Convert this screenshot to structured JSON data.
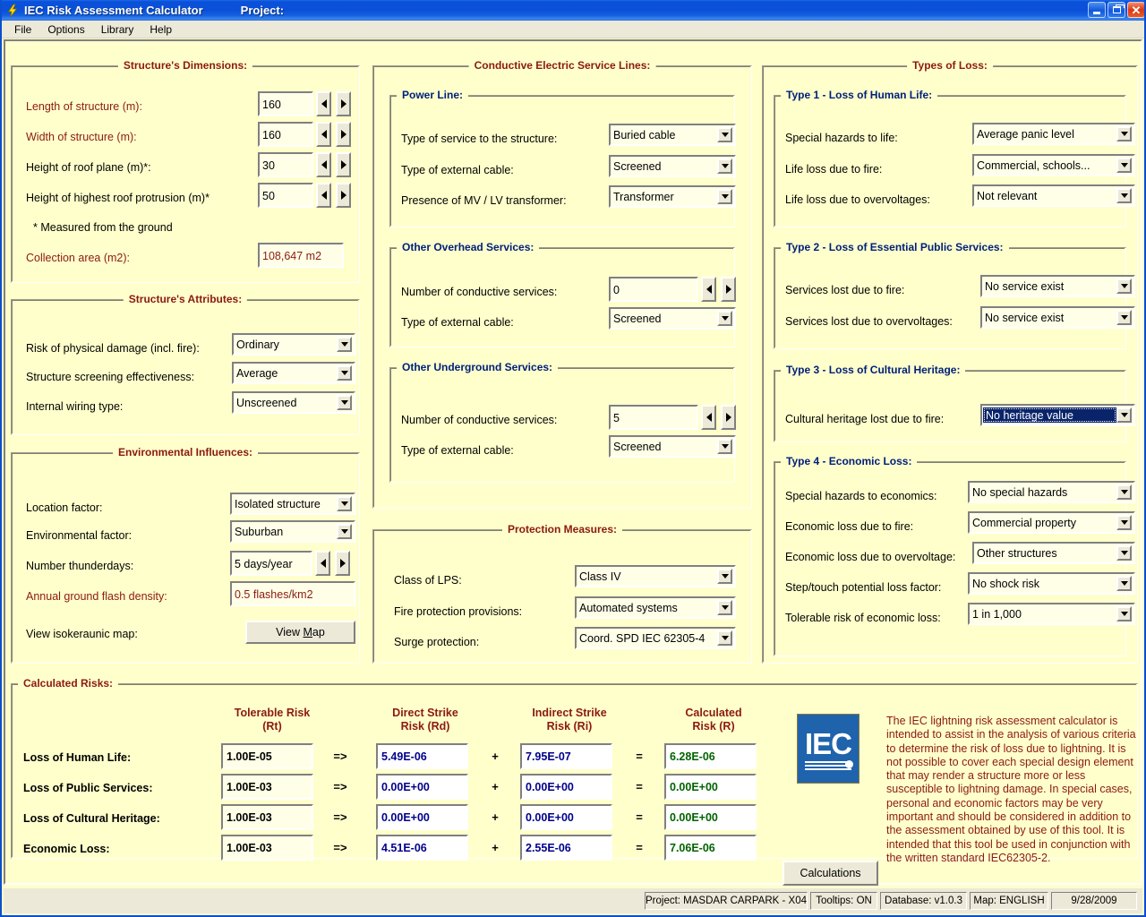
{
  "window": {
    "title": "IEC Risk Assessment Calculator",
    "project_label": "Project:",
    "icon": "lightning-bolt-icon",
    "minimize": "minimize-icon",
    "restore": "restore-icon",
    "close": "close-icon"
  },
  "menu": [
    "File",
    "Options",
    "Library",
    "Help"
  ],
  "structure_dimensions": {
    "title": "Structure's Dimensions:",
    "fields": [
      {
        "label": "Length of structure (m):",
        "value": "160"
      },
      {
        "label": "Width of structure (m):",
        "value": "160"
      },
      {
        "label": "Height of roof plane (m)*:",
        "value": "30"
      },
      {
        "label": "Height of highest roof protrusion (m)*",
        "value": "50"
      }
    ],
    "note": "* Measured from the ground",
    "collection_area_label": "Collection area (m2):",
    "collection_area_value": "108,647 m2"
  },
  "structure_attributes": {
    "title": "Structure's Attributes:",
    "rows": [
      {
        "label": "Risk of physical damage (incl. fire):",
        "value": "Ordinary"
      },
      {
        "label": "Structure screening effectiveness:",
        "value": "Average"
      },
      {
        "label": "Internal wiring type:",
        "value": "Unscreened"
      }
    ]
  },
  "environmental_influences": {
    "title": "Environmental Influences:",
    "location_factor_label": "Location factor:",
    "location_factor_value": "Isolated structure",
    "environmental_factor_label": "Environmental factor:",
    "environmental_factor_value": "Suburban",
    "thunderdays_label": "Number thunderdays:",
    "thunderdays_value": "5 days/year",
    "flash_density_label": "Annual ground flash density:",
    "flash_density_value": "0.5  flashes/km2",
    "map_label": "View isokeraunic map:",
    "map_button": "View Map"
  },
  "conductive_lines": {
    "title": "Conductive Electric Service Lines:",
    "power_line": {
      "title": "Power Line:",
      "rows": [
        {
          "label": "Type of service to the structure:",
          "value": "Buried cable"
        },
        {
          "label": "Type of external cable:",
          "value": "Screened"
        },
        {
          "label": "Presence of MV / LV transformer:",
          "value": "Transformer"
        }
      ]
    },
    "overhead": {
      "title": "Other Overhead Services:",
      "count_label": "Number of conductive services:",
      "count_value": "0",
      "cable_label": "Type of external cable:",
      "cable_value": "Screened"
    },
    "underground": {
      "title": "Other Underground Services:",
      "count_label": "Number of conductive services:",
      "count_value": "5",
      "cable_label": "Type of external cable:",
      "cable_value": "Screened"
    }
  },
  "protection_measures": {
    "title": "Protection Measures:",
    "rows": [
      {
        "label": "Class of LPS:",
        "value": "Class IV"
      },
      {
        "label": "Fire protection provisions:",
        "value": "Automated systems"
      },
      {
        "label": "Surge protection:",
        "value": "Coord. SPD IEC 62305-4"
      }
    ]
  },
  "types_of_loss": {
    "title": "Types of Loss:",
    "type1": {
      "title": "Type 1 - Loss of Human Life:",
      "rows": [
        {
          "label": "Special hazards to life:",
          "value": "Average panic level"
        },
        {
          "label": "Life loss due to fire:",
          "value": "Commercial, schools..."
        },
        {
          "label": "Life loss due to overvoltages:",
          "value": "Not relevant"
        }
      ]
    },
    "type2": {
      "title": "Type 2 - Loss of Essential Public Services:",
      "rows": [
        {
          "label": "Services lost due to fire:",
          "value": "No service exist"
        },
        {
          "label": "Services lost due to overvoltages:",
          "value": "No service exist"
        }
      ]
    },
    "type3": {
      "title": "Type 3 - Loss of Cultural Heritage:",
      "rows": [
        {
          "label": "Cultural heritage lost due to fire:",
          "value": "No heritage value"
        }
      ]
    },
    "type4": {
      "title": "Type 4 - Economic Loss:",
      "rows": [
        {
          "label": "Special hazards to economics:",
          "value": "No special hazards"
        },
        {
          "label": "Economic loss due to fire:",
          "value": "Commercial property"
        },
        {
          "label": "Economic loss due to overvoltage:",
          "value": "Other structures"
        },
        {
          "label": "Step/touch potential loss factor:",
          "value": "No shock risk"
        },
        {
          "label": "Tolerable risk of economic loss:",
          "value": "1 in 1,000"
        }
      ]
    }
  },
  "calculated_risks": {
    "title": "Calculated Risks:",
    "headers": {
      "tolerable": [
        "Tolerable Risk",
        "(Rt)"
      ],
      "direct": [
        "Direct Strike",
        "Risk (Rd)"
      ],
      "indirect": [
        "Indirect Strike",
        "Risk (Ri)"
      ],
      "calculated": [
        "Calculated",
        "Risk (R)"
      ]
    },
    "op_arrow": "=>",
    "op_plus": "+",
    "op_equals": "=",
    "rows": [
      {
        "label": "Loss of Human Life:",
        "rt": "1.00E-05",
        "rd": "5.49E-06",
        "ri": "7.95E-07",
        "r": "6.28E-06"
      },
      {
        "label": "Loss of Public Services:",
        "rt": "1.00E-03",
        "rd": "0.00E+00",
        "ri": "0.00E+00",
        "r": "0.00E+00"
      },
      {
        "label": "Loss of Cultural Heritage:",
        "rt": "1.00E-03",
        "rd": "0.00E+00",
        "ri": "0.00E+00",
        "r": "0.00E+00"
      },
      {
        "label": "Economic Loss:",
        "rt": "1.00E-03",
        "rd": "4.51E-06",
        "ri": "2.55E-06",
        "r": "7.06E-06"
      }
    ]
  },
  "info": {
    "logo_text": "IEC",
    "description": "The IEC lightning risk assessment calculator is intended to assist in the analysis of various criteria to determine the risk of loss due to lightning. It is not possible to cover each special design element that may render a structure more or less susceptible to lightning damage. In special cases, personal and economic factors may be very important and should be considered in addition to the assessment obtained by use of this tool. It is intended that this tool be used in conjunction with the written standard IEC62305-2.",
    "calculations_button": "Calculations"
  },
  "statusbar": {
    "project": "Project: MASDAR CARPARK - X04",
    "tooltips": "Tooltips: ON",
    "database": "Database: v1.0.3",
    "map": "Map: ENGLISH",
    "date": "9/28/2009"
  },
  "colors": {
    "background": "#FFFFCC",
    "group_title": "#8B1A11",
    "nested_group_title": "#00207A",
    "risk_blue": "#00008B",
    "risk_green": "#006400",
    "title_bar": "#0A50D8",
    "iec_blue": "#1F63AD"
  }
}
